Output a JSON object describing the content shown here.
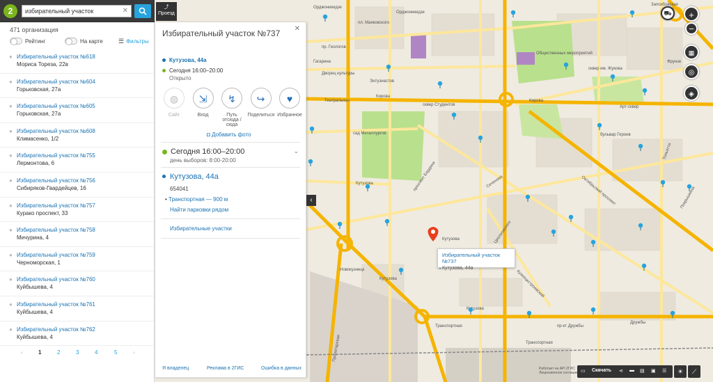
{
  "search": {
    "value": "избирательный участок",
    "clear": "✕",
    "route_label": "Проезд"
  },
  "sidebar": {
    "count": "471 организация",
    "toggle_rating": "Рейтинг",
    "toggle_map": "На карте",
    "filters": "Фильтры",
    "items": [
      {
        "title": "Избирательный участок №618",
        "address": "Мориса Тореза, 22в"
      },
      {
        "title": "Избирательный участок №604",
        "address": "Горьковская, 27а"
      },
      {
        "title": "Избирательный участок №605",
        "address": "Горьковская, 27а"
      },
      {
        "title": "Избирательный участок №608",
        "address": "Климасенко, 1/2"
      },
      {
        "title": "Избирательный участок №755",
        "address": "Лермонтова, 6"
      },
      {
        "title": "Избирательный участок №756",
        "address": "Сибиряков-Гвардейцев, 16"
      },
      {
        "title": "Избирательный участок №757",
        "address": "Курако проспект, 33"
      },
      {
        "title": "Избирательный участок №758",
        "address": "Мичурина, 4"
      },
      {
        "title": "Избирательный участок №759",
        "address": "Черноморская, 1"
      },
      {
        "title": "Избирательный участок №760",
        "address": "Куйбышева, 4"
      },
      {
        "title": "Избирательный участок №761",
        "address": "Куйбышева, 4"
      },
      {
        "title": "Избирательный участок №762",
        "address": "Куйбышева, 4"
      }
    ],
    "pager": {
      "prev": "‹",
      "pages": [
        "1",
        "2",
        "3",
        "4",
        "5"
      ],
      "next": "›"
    }
  },
  "card": {
    "title": "Избирательный участок №737",
    "close": "✕",
    "address": "Кутузова, 44а",
    "today": "Сегодня 16:00–20:00",
    "status": "Открыто",
    "actions": [
      {
        "label": "Сайт",
        "icon": "globe-icon",
        "glyph": "◍"
      },
      {
        "label": "Вход",
        "icon": "entrance-icon",
        "glyph": "⇲"
      },
      {
        "label": "Путь отсюда / сюда",
        "icon": "route-icon",
        "glyph": "↯"
      },
      {
        "label": "Поделиться",
        "icon": "share-icon",
        "glyph": "↪"
      },
      {
        "label": "Избранное",
        "icon": "heart-icon",
        "glyph": "♥"
      }
    ],
    "add_photo": "Добавить фото",
    "big_time": "Сегодня 16:00–20:00",
    "election_day": "день выборов: 8:00-20:00",
    "address_big": "Кутузова, 44а",
    "postcode": "654041",
    "transport": "Транспортная — 900 м",
    "parking": "Найти парковки рядом",
    "category": "Избирательные участки",
    "footer": {
      "owner": "Я владелец",
      "ads": "Реклама в 2ГИС",
      "error": "Ошибка в данных"
    }
  },
  "map": {
    "popup_title": "Избирательный участок №737",
    "popup_address": "Кутузова, 44а",
    "labels": [
      "Орджоникидзе",
      "Орджоникидзе",
      "пл. Маяковского",
      "пр. Геологов",
      "Гагарина",
      "Дворец культуры",
      "Энтузиастов",
      "Кирова",
      "Кирова",
      "Арт-сквер",
      "сквер Студентов",
      "сад Металлургов",
      "Театральная",
      "проспект Бардина",
      "Кутузова",
      "Кутузова",
      "Кутузова",
      "Сеченова",
      "Циолковского",
      "Октябрьский проспект",
      "Транспортная",
      "Транспортная",
      "Новокузнецк",
      "Запсибовская",
      "Фрунзе",
      "сквер им. Жукова",
      "бульвар Героев",
      "Тольятти",
      "Покрышкина",
      "Кутузова",
      "пр-кт Дружбы",
      "Пролетарская",
      "Дружбы",
      "Общественных мероприятий",
      "Кузнецкстроевский"
    ],
    "credit_1": "Работает на API 2ГИС",
    "credit_2": "Лицензионное соглашение",
    "download": "Скачать",
    "colors": {
      "arterial": "#f5b400",
      "road": "#fde79b",
      "park": "#b9e08d",
      "block": "#e6e0d4",
      "pin": "#27a3dd",
      "selected": "#e8401c"
    }
  }
}
